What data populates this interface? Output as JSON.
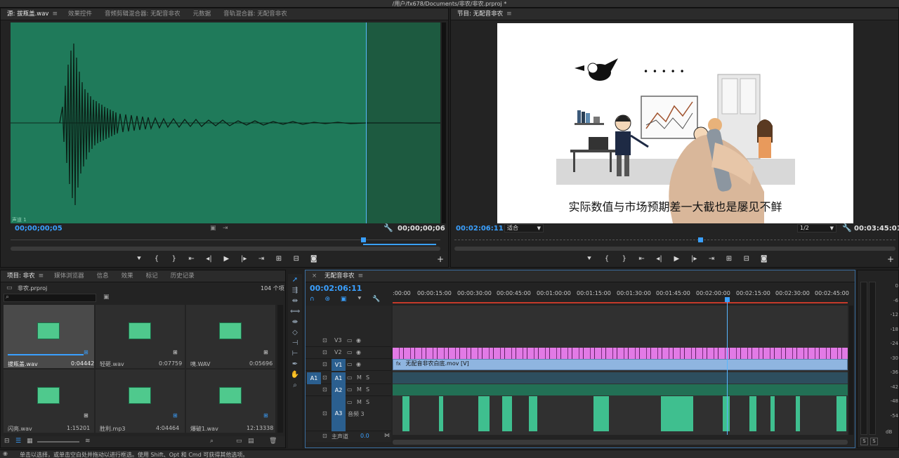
{
  "window": {
    "title": "/用户/fx678/Documents/非农/非农.prproj *"
  },
  "source_panel": {
    "tabs": [
      "源: 拔瓶盖.wav",
      "效果控件",
      "音频剪辑混合器: 无配音非农",
      "元数据",
      "音轨混合器: 无配音非农"
    ],
    "channel_label": "声道 1",
    "timecode_left": "00;00;00;05",
    "timecode_right": "00;00;00;06"
  },
  "program_panel": {
    "tab": "节目: 无配音非农",
    "subtitle": "实际数值与市场预期差一大截也是屡见不鲜",
    "timecode_left": "00:02:06:11",
    "fit_option": "适合",
    "resolution": "1/2",
    "timecode_right": "00:03:45:01",
    "dots": "• • • • •"
  },
  "project_panel": {
    "tabs": [
      "项目: 非农",
      "媒体浏览器",
      "信息",
      "效果",
      "标记",
      "历史记录"
    ],
    "file": "非农.prproj",
    "item_count": "104 个项",
    "items": [
      {
        "name": "拔瓶盖.wav",
        "duration": "0:04442"
      },
      {
        "name": "轻砸.wav",
        "duration": "0:07759"
      },
      {
        "name": "咦.WAV",
        "duration": "0:05696"
      },
      {
        "name": "闪亮.wav",
        "duration": "1:15201"
      },
      {
        "name": "胜利.mp3",
        "duration": "4:04464"
      },
      {
        "name": "爆破1.wav",
        "duration": "12:13338"
      }
    ]
  },
  "timeline": {
    "tab": "无配音非农",
    "timecode": "00:02:06:11",
    "ruler": [
      ":00:00",
      "00:00:15:00",
      "00:00:30:00",
      "00:00:45:00",
      "00:01:00:00",
      "00:01:15:00",
      "00:01:30:00",
      "00:01:45:00",
      "00:02:00:00",
      "00:02:15:00",
      "00:02:30:00",
      "00:02:45:00"
    ],
    "tracks": {
      "v3": "V3",
      "v2": "V2",
      "v1": "V1",
      "a1_src": "A1",
      "a1": "A1",
      "a2": "A2",
      "a3": "A3",
      "a3_name": "音频 3",
      "master": "主声道",
      "master_value": "0.0",
      "m": "M",
      "s": "S"
    },
    "v1_clip": "无配音非农白底.mov [V]"
  },
  "meters": {
    "scale": [
      "0",
      "-6",
      "-12",
      "-18",
      "-24",
      "-30",
      "-36",
      "-42",
      "-48",
      "-54",
      "dB"
    ],
    "s_left": "S",
    "s_right": "S"
  },
  "status_bar": {
    "text": "单击以选择，或单击空白处并拖动以进行框选。使用 Shift、Opt 和 Cmd 可获得其他选项。"
  },
  "colors": {
    "waveform_bg": "#1f7a5a",
    "timecode_blue": "#3aa0ff",
    "v2_clip": "#e27ae6",
    "v1_clip": "#8fb5e0",
    "audio_clip": "#3fbf8f"
  }
}
